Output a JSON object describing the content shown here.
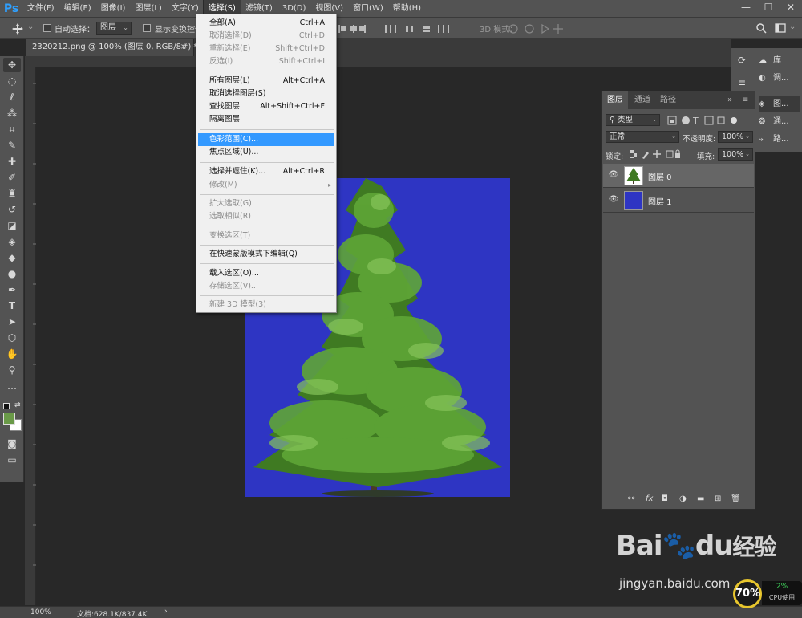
{
  "app": {
    "logo": "Ps"
  },
  "menubar": {
    "items": [
      "文件(F)",
      "编辑(E)",
      "图像(I)",
      "图层(L)",
      "文字(Y)",
      "选择(S)",
      "滤镜(T)",
      "3D(D)",
      "视图(V)",
      "窗口(W)",
      "帮助(H)"
    ],
    "active_index": 5,
    "window_controls": [
      "—",
      "☐",
      "✕"
    ]
  },
  "options": {
    "auto_select_label": "自动选择：",
    "auto_select_value": "图层",
    "show_transform_label": "显示变换控件",
    "mode_3d_label": "3D 模式："
  },
  "document": {
    "tab_title": "2320212.png @ 100% (图层 0, RGB/8#) *",
    "tab_close": "×"
  },
  "select_menu": {
    "items": [
      {
        "label": "全部(A)",
        "shortcut": "Ctrl+A",
        "disabled": false
      },
      {
        "label": "取消选择(D)",
        "shortcut": "Ctrl+D",
        "disabled": true
      },
      {
        "label": "重新选择(E)",
        "shortcut": "Shift+Ctrl+D",
        "disabled": true
      },
      {
        "label": "反选(I)",
        "shortcut": "Shift+Ctrl+I",
        "disabled": true
      },
      {
        "label": "所有图层(L)",
        "shortcut": "Alt+Ctrl+A",
        "disabled": false
      },
      {
        "label": "取消选择图层(S)",
        "shortcut": "",
        "disabled": false
      },
      {
        "label": "查找图层",
        "shortcut": "Alt+Shift+Ctrl+F",
        "disabled": false
      },
      {
        "label": "隔离图层",
        "shortcut": "",
        "disabled": false
      },
      {
        "label": "色彩范围(C)...",
        "shortcut": "",
        "disabled": false
      },
      {
        "label": "焦点区域(U)...",
        "shortcut": "",
        "disabled": false
      },
      {
        "label": "选择并遮住(K)...",
        "shortcut": "Alt+Ctrl+R",
        "disabled": false
      },
      {
        "label": "修改(M)",
        "shortcut": "",
        "disabled": true
      },
      {
        "label": "扩大选取(G)",
        "shortcut": "",
        "disabled": true
      },
      {
        "label": "选取相似(R)",
        "shortcut": "",
        "disabled": true
      },
      {
        "label": "变换选区(T)",
        "shortcut": "",
        "disabled": true
      },
      {
        "label": "在快速蒙版模式下编辑(Q)",
        "shortcut": "",
        "disabled": false
      },
      {
        "label": "载入选区(O)...",
        "shortcut": "",
        "disabled": false
      },
      {
        "label": "存储选区(V)...",
        "shortcut": "",
        "disabled": true
      },
      {
        "label": "新建 3D 模型(3)",
        "shortcut": "",
        "disabled": true
      }
    ],
    "highlighted_index": 8,
    "submenu_arrow": "▸"
  },
  "right_strip": {
    "items": [
      "库",
      "调...",
      "图...",
      "通...",
      "路..."
    ]
  },
  "layers_panel": {
    "tabs": [
      "图层",
      "通道",
      "路径"
    ],
    "active_tab": 0,
    "filter_label": "类型",
    "blend_mode": "正常",
    "opacity_label": "不透明度:",
    "opacity_value": "100%",
    "lock_label": "锁定:",
    "fill_label": "填充:",
    "fill_value": "100%",
    "layers": [
      {
        "name": "图层 0",
        "selected": true,
        "thumb": "tree"
      },
      {
        "name": "图层 1",
        "selected": false,
        "thumb": "blue"
      }
    ],
    "bottom_fx": "fx"
  },
  "status": {
    "zoom": "100%",
    "doc_info": "文档:628.1K/837.4K",
    "arrow": "›"
  },
  "perf": {
    "value": "70%",
    "cpu_pct": "2%",
    "cpu_label": "CPU使用"
  },
  "watermark": {
    "brand": "Bai",
    "brand_du": "du",
    "suffix": "经验",
    "url": "jingyan.baidu.com"
  },
  "colors": {
    "canvas_bg": "#282828",
    "image_bg": "#2e35c3",
    "highlight": "#3399ff",
    "foreground": "#6a9a48",
    "background": "#ffffff"
  }
}
